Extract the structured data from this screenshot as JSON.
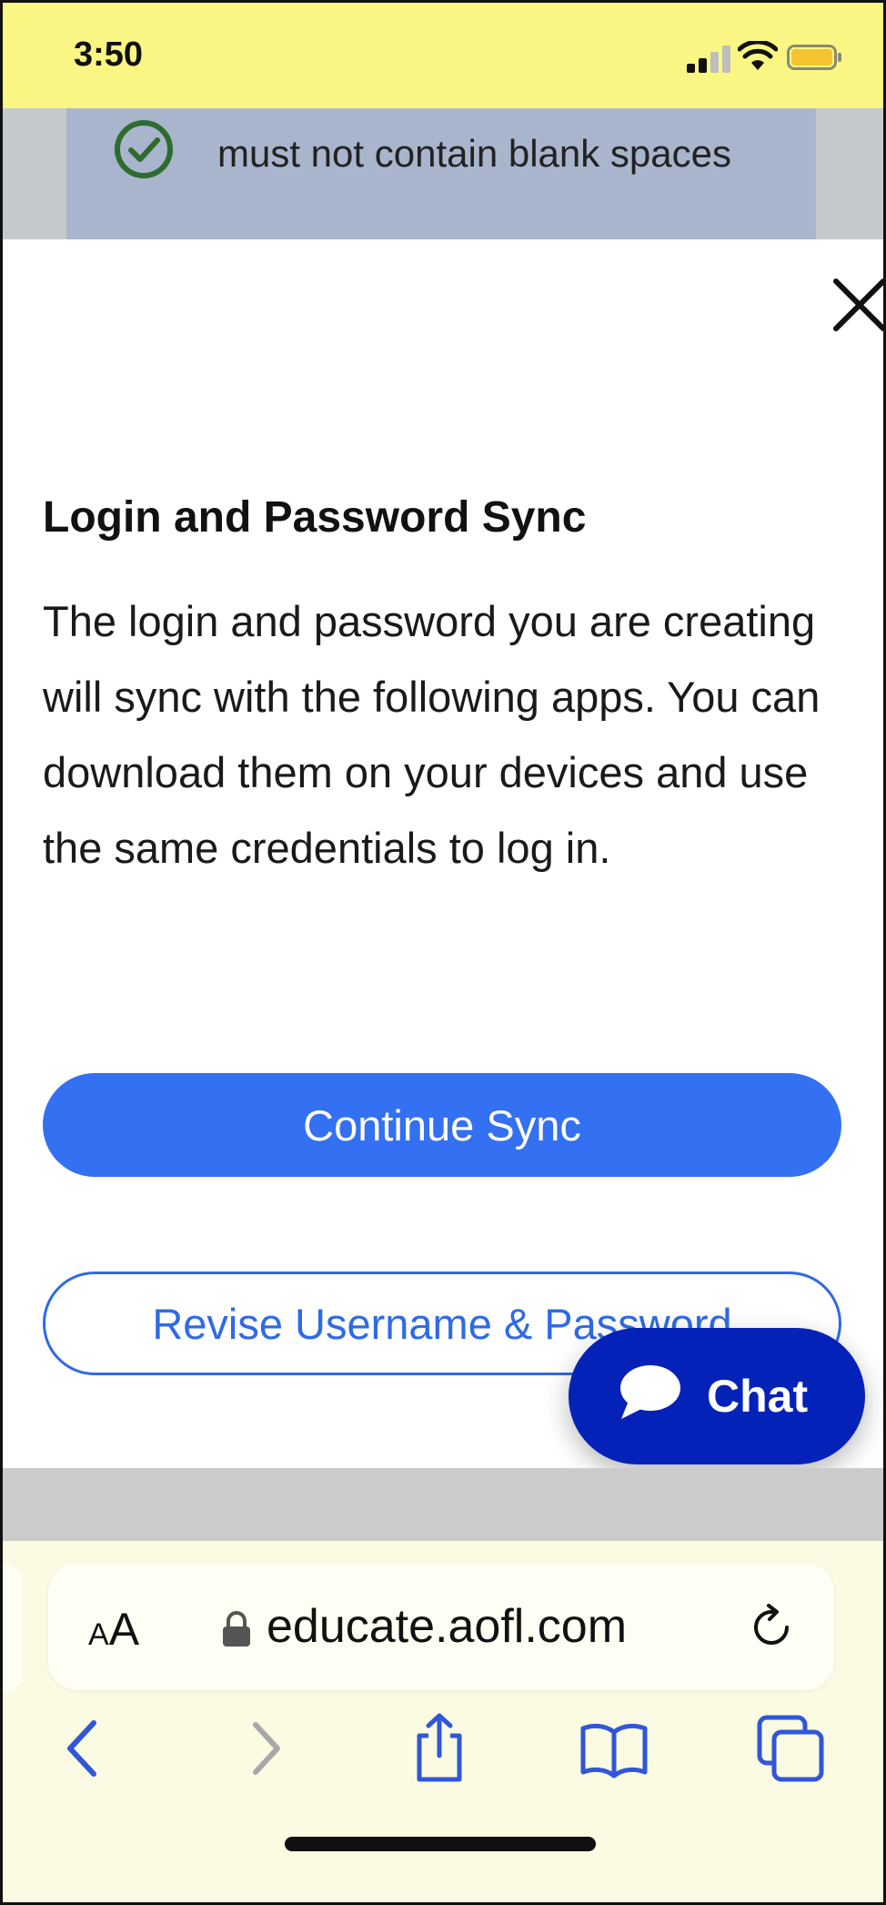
{
  "status_bar": {
    "time": "3:50"
  },
  "underlay": {
    "requirement_text": "must not contain blank spaces"
  },
  "modal": {
    "title": "Login and Password Sync",
    "body": "The login and password you are creating will sync with the following apps. You can download them on your devices and use the same credentials to log in.",
    "primary_button": "Continue Sync",
    "secondary_button": "Revise Username & Password"
  },
  "chat": {
    "label": "Chat"
  },
  "browser": {
    "text_size_label_small": "A",
    "text_size_label_large": "A",
    "url": "educate.aofl.com"
  },
  "colors": {
    "primary": "#3370f2",
    "chat": "#0522b8",
    "status_bar": "#faf683",
    "success": "#2e6b2e"
  }
}
